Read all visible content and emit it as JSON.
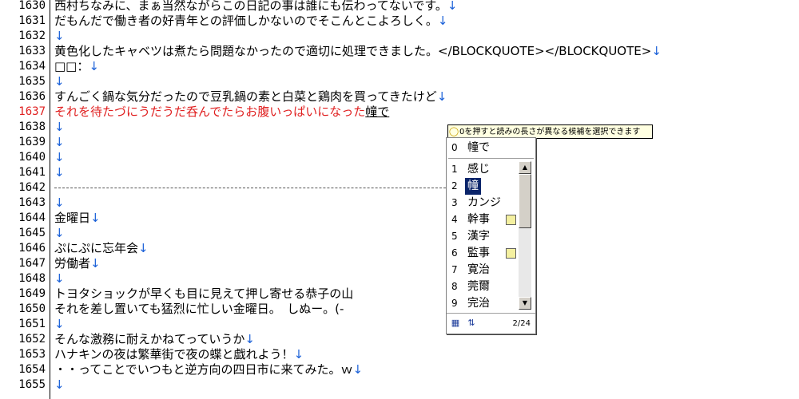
{
  "editor": {
    "lines": [
      {
        "n": "1630",
        "t": "西村ちなみに、まぁ当然ながらこの日記の事は誰にも伝わってないです。",
        "eol": "↓"
      },
      {
        "n": "1631",
        "t": "だもんだで働き者の好青年との評価しかないのでそこんとこよろしく。",
        "eol": "↓"
      },
      {
        "n": "1632",
        "t": "",
        "eol": "↓"
      },
      {
        "n": "1633",
        "t": "黄色化したキャベツは煮たら問題なかったので適切に処理できました。</BLOCKQUOTE></BLOCKQUOTE>",
        "eol": "↓"
      },
      {
        "n": "1634",
        "t": "□□：",
        "eol": "↓"
      },
      {
        "n": "1635",
        "t": "",
        "eol": "↓"
      },
      {
        "n": "1636",
        "t": "すんごく鍋な気分だったので豆乳鍋の素と白菜と鶏肉を買ってきたけど",
        "eol": "↓"
      },
      {
        "n": "1637",
        "t": "それを待たづにうだうだ呑んでたらお腹いっぱいになった",
        "eol": "",
        "red": true,
        "comp": "幢で"
      },
      {
        "n": "1638",
        "t": "",
        "eol": "↓"
      },
      {
        "n": "1639",
        "t": "",
        "eol": "↓"
      },
      {
        "n": "1640",
        "t": "",
        "eol": "↓"
      },
      {
        "n": "1641",
        "t": "",
        "eol": "↓"
      },
      {
        "n": "1642",
        "t": "",
        "eol": "",
        "dash": true
      },
      {
        "n": "1643",
        "t": "",
        "eol": "↓"
      },
      {
        "n": "1644",
        "t": "金曜日",
        "eol": "↓"
      },
      {
        "n": "1645",
        "t": "",
        "eol": "↓"
      },
      {
        "n": "1646",
        "t": "ぷにぷに忘年会",
        "eol": "↓"
      },
      {
        "n": "1647",
        "t": "労働者",
        "eol": "↓"
      },
      {
        "n": "1648",
        "t": "",
        "eol": "↓"
      },
      {
        "n": "1649",
        "t": "トヨタショックが早くも目に見えて押し寄せる恭子の山",
        "eol": ""
      },
      {
        "n": "1650",
        "t": "それを差し置いても猛烈に忙しい金曜日。　しぬー。(-",
        "eol": ""
      },
      {
        "n": "1651",
        "t": "",
        "eol": "↓"
      },
      {
        "n": "1652",
        "t": "そんな激務に耐えかねてっていうか",
        "eol": "↓"
      },
      {
        "n": "1653",
        "t": "ハナキンの夜は繁華街で夜の蝶と戯れよう！",
        "eol": "↓"
      },
      {
        "n": "1654",
        "t": "・・ってことでいつもと逆方向の四日市に来てみた。ｗ",
        "eol": "↓"
      },
      {
        "n": "1655",
        "t": "",
        "eol": "↓"
      }
    ]
  },
  "ime": {
    "tip": "0を押すと読みの長さが異なる候補を選択できます",
    "current": {
      "num": "0",
      "word": "幢で"
    },
    "candidates": [
      {
        "num": "1",
        "word": "感じ",
        "note": false
      },
      {
        "num": "2",
        "word": "幢",
        "note": false,
        "selected": true
      },
      {
        "num": "3",
        "word": "カンジ",
        "note": false
      },
      {
        "num": "4",
        "word": "幹事",
        "note": true
      },
      {
        "num": "5",
        "word": "漢字",
        "note": false
      },
      {
        "num": "6",
        "word": "監事",
        "note": true
      },
      {
        "num": "7",
        "word": "寛治",
        "note": false
      },
      {
        "num": "8",
        "word": "莞爾",
        "note": false
      },
      {
        "num": "9",
        "word": "完治",
        "note": false
      }
    ],
    "page": "2/24",
    "scroll_up": "▲",
    "scroll_down": "▼"
  }
}
